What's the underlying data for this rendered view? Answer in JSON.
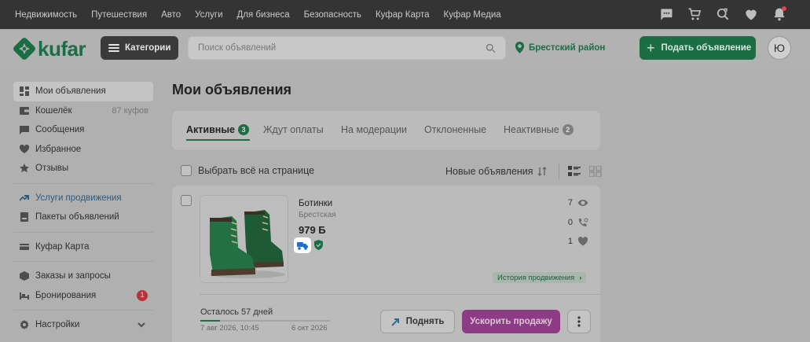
{
  "topbar": {
    "links": [
      "Недвижимость",
      "Путешествия",
      "Авто",
      "Услуги",
      "Для бизнеса",
      "Безопасность",
      "Куфар Карта",
      "Куфар Медиа"
    ],
    "icons": [
      "chat-icon",
      "cart-icon",
      "search-history-icon",
      "favorites-icon",
      "notifications-icon"
    ]
  },
  "header": {
    "logo_text": "kufar",
    "categories_label": "Категории",
    "search_placeholder": "Поиск объявлений",
    "region": "Брестский район",
    "post_label": "Подать объявление",
    "avatar_letter": "Ю"
  },
  "sidebar": {
    "items": [
      {
        "label": "Мои объявления",
        "icon": "grid-icon"
      },
      {
        "label": "Кошелёк",
        "icon": "wallet-icon",
        "extra": "87 куфов"
      },
      {
        "label": "Сообщения",
        "icon": "message-icon"
      },
      {
        "label": "Избранное",
        "icon": "heart-icon"
      },
      {
        "label": "Отзывы",
        "icon": "star-icon"
      },
      {
        "label": "Услуги продвижения",
        "icon": "trend-icon"
      },
      {
        "label": "Пакеты объявлений",
        "icon": "package-icon"
      },
      {
        "label": "Куфар Карта",
        "icon": "card-icon"
      },
      {
        "label": "Заказы и запросы",
        "icon": "box-icon"
      },
      {
        "label": "Бронирования",
        "icon": "bed-icon",
        "badge": "1"
      },
      {
        "label": "Настройки",
        "icon": "gear-icon"
      }
    ]
  },
  "main": {
    "title": "Мои объявления",
    "tabs": [
      {
        "label": "Активные",
        "count": "3"
      },
      {
        "label": "Ждут оплаты"
      },
      {
        "label": "На модерации"
      },
      {
        "label": "Отклоненные"
      },
      {
        "label": "Неактивные",
        "count": "2"
      }
    ],
    "select_all": "Выбрать всё на странице",
    "sort_label": "Новые объявления"
  },
  "ad": {
    "title": "Ботинки",
    "location": "Брестская",
    "price": "979 Б",
    "views": "7",
    "calls": "0",
    "favorites": "1",
    "promo_history": "История продвижения",
    "remaining": "Осталось 57 дней",
    "remaining_fraction": 0.15,
    "date_from": "7 авг 2026, 10:45",
    "date_to": "6 окт 2026",
    "raise_label": "Поднять",
    "boost_label": "Ускорить продажу"
  },
  "colors": {
    "brand_green": "#1b6e43",
    "boost_purple": "#8e3b85",
    "badge_red": "#b7333b",
    "delivery_blue": "#1f6fd1"
  }
}
